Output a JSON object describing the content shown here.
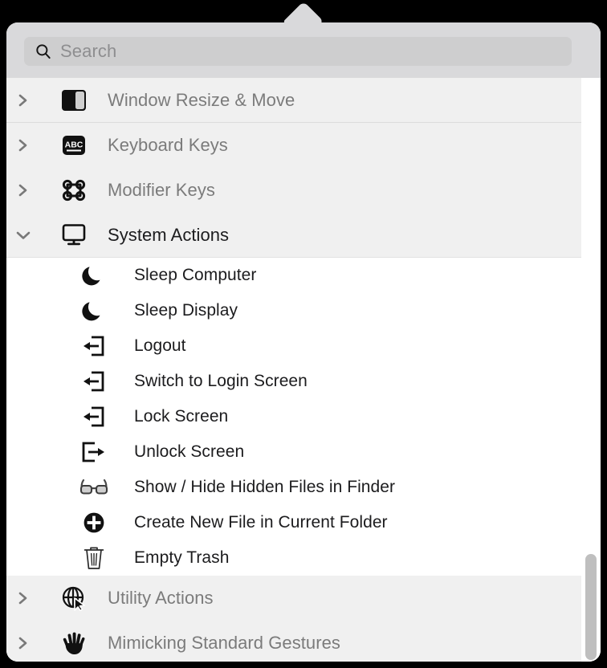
{
  "window": {
    "accent_bg": "#d9d9db",
    "list_bg": "#ffffff",
    "group_bg": "#f0f0f0"
  },
  "search": {
    "placeholder": "Search",
    "value": "",
    "icon": "search-icon"
  },
  "list": {
    "groups": [
      {
        "label": "Window Resize & Move",
        "icon": "window-split-icon",
        "expanded": false,
        "chevron": "chevron-right-icon",
        "children": []
      },
      {
        "label": "Keyboard Keys",
        "icon": "abc-keyboard-icon",
        "expanded": false,
        "chevron": "chevron-right-icon",
        "children": []
      },
      {
        "label": "Modifier Keys",
        "icon": "command-key-icon",
        "expanded": false,
        "chevron": "chevron-right-icon",
        "children": []
      },
      {
        "label": "System Actions",
        "icon": "display-monitor-icon",
        "expanded": true,
        "chevron": "chevron-down-icon",
        "children": [
          {
            "label": "Sleep Computer",
            "icon": "moon-icon"
          },
          {
            "label": "Sleep Display",
            "icon": "moon-icon"
          },
          {
            "label": "Logout",
            "icon": "logout-arrow-icon"
          },
          {
            "label": "Switch to Login Screen",
            "icon": "logout-arrow-icon"
          },
          {
            "label": "Lock Screen",
            "icon": "logout-arrow-icon"
          },
          {
            "label": "Unlock Screen",
            "icon": "unlock-arrow-icon"
          },
          {
            "label": "Show / Hide Hidden Files in Finder",
            "icon": "glasses-icon"
          },
          {
            "label": "Create New File in Current Folder",
            "icon": "plus-circle-icon"
          },
          {
            "label": "Empty Trash",
            "icon": "trash-icon"
          }
        ]
      },
      {
        "label": "Utility Actions",
        "icon": "globe-cursor-icon",
        "expanded": false,
        "chevron": "chevron-right-icon",
        "children": []
      },
      {
        "label": "Mimicking Standard Gestures",
        "icon": "hand-icon",
        "expanded": false,
        "chevron": "chevron-right-icon",
        "children": []
      }
    ]
  },
  "scrollbar": {
    "orientation": "vertical",
    "thumb_color": "#bfbfbf"
  }
}
